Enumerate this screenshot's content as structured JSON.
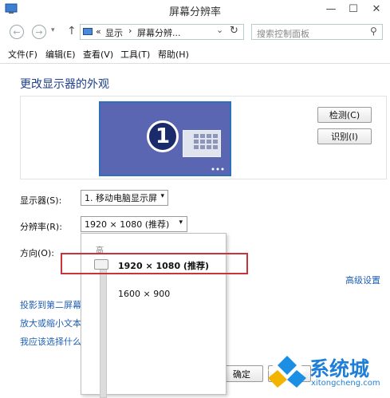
{
  "window": {
    "title": "屏幕分辨率",
    "minimize": "—",
    "maximize": "☐",
    "close": "✕"
  },
  "nav": {
    "back": "←",
    "forward": "→",
    "up": "↑",
    "breadcrumb_sep": "«",
    "crumb1": "显示",
    "crumb_arrow": "›",
    "crumb2": "屏幕分辨...",
    "dropdown_arrow": "⌄",
    "refresh": "↻",
    "search_placeholder": "搜索控制面板",
    "search_icon_glyph": "⚲"
  },
  "menu": [
    "文件(F)",
    "编辑(E)",
    "查看(V)",
    "工具(T)",
    "帮助(H)"
  ],
  "main": {
    "heading": "更改显示器的外观",
    "monitor_number": "1",
    "detect_button": "检测(C)",
    "identify_button": "识别(I)",
    "display_label": "显示器(S):",
    "display_value": "1. 移动电脑显示屏",
    "resolution_label": "分辨率(R):",
    "resolution_value": "1920 × 1080 (推荐)",
    "orientation_label": "方向(O):",
    "advanced_link": "高级设置",
    "links": [
      "投影到第二屏幕",
      "放大或缩小文本",
      "我应该选择什么"
    ],
    "ok_button": "确定",
    "cancel_button": "取"
  },
  "dropdown": {
    "high_label": "高",
    "option_selected": "1920 × 1080 (推荐)",
    "option_second": "1600 × 900"
  },
  "watermark": {
    "name": "系统城",
    "url": "xitongcheng.com"
  }
}
